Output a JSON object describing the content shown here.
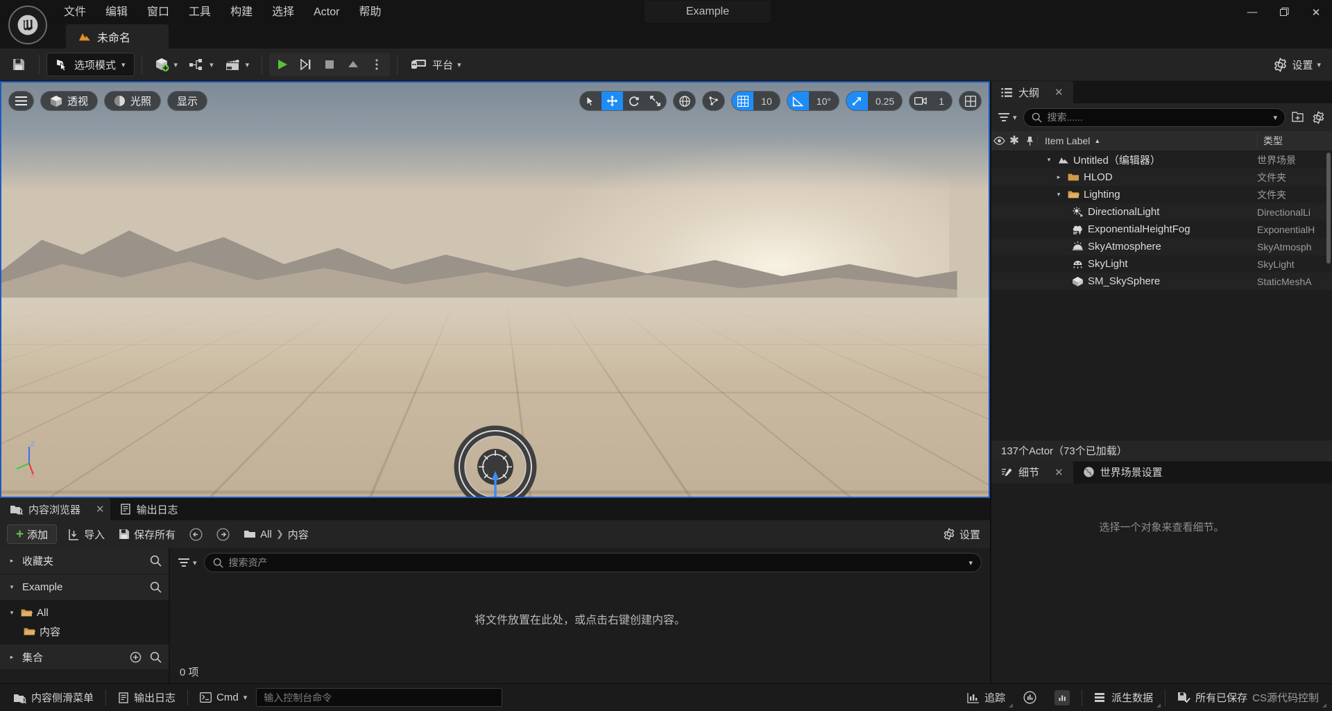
{
  "window": {
    "title": "Example",
    "minimize_label": "—",
    "maximize_label": "❐",
    "close_label": "✕"
  },
  "menubar": {
    "items": [
      {
        "label": "文件"
      },
      {
        "label": "编辑"
      },
      {
        "label": "窗口"
      },
      {
        "label": "工具"
      },
      {
        "label": "构建"
      },
      {
        "label": "选择"
      },
      {
        "label": "Actor"
      },
      {
        "label": "帮助"
      }
    ]
  },
  "level_tab": {
    "label": "未命名"
  },
  "toolbar": {
    "save_tooltip": "保存",
    "mode_label": "选项模式",
    "platform_label": "平台",
    "settings_label": "设置"
  },
  "viewport": {
    "menu_label": "☰",
    "perspective_label": "透视",
    "lighting_label": "光照",
    "show_label": "显示",
    "grid_snap_value": "10",
    "angle_snap_value": "10°",
    "scale_snap_value": "0.25",
    "camera_speed_value": "1",
    "axis_x": "X",
    "axis_y": "Y",
    "axis_z": "Z"
  },
  "outliner": {
    "tab_label": "大纲",
    "close_label": "✕",
    "search_placeholder": "搜索......",
    "columns": {
      "label": "Item Label",
      "type": "类型",
      "sort_arrow": "▲"
    },
    "rows": [
      {
        "name": "Untitled（编辑器）",
        "type": "世界场景",
        "depth": 1,
        "disclosure": "open",
        "icon": "world-icon"
      },
      {
        "name": "HLOD",
        "type": "文件夹",
        "depth": 2,
        "disclosure": "closed",
        "icon": "folder-closed-icon"
      },
      {
        "name": "Lighting",
        "type": "文件夹",
        "depth": 2,
        "disclosure": "open",
        "icon": "folder-open-icon"
      },
      {
        "name": "DirectionalLight",
        "type": "DirectionalLi",
        "depth": 3,
        "disclosure": "none",
        "icon": "directional-light-icon"
      },
      {
        "name": "ExponentialHeightFog",
        "type": "ExponentialH",
        "depth": 3,
        "disclosure": "none",
        "icon": "fog-icon"
      },
      {
        "name": "SkyAtmosphere",
        "type": "SkyAtmosph",
        "depth": 3,
        "disclosure": "none",
        "icon": "sky-atmosphere-icon"
      },
      {
        "name": "SkyLight",
        "type": "SkyLight",
        "depth": 3,
        "disclosure": "none",
        "icon": "sky-light-icon"
      },
      {
        "name": "SM_SkySphere",
        "type": "StaticMeshA",
        "depth": 3,
        "disclosure": "none",
        "icon": "static-mesh-icon"
      }
    ],
    "status": "137个Actor（73个已加载）"
  },
  "details": {
    "tab_label": "细节",
    "close_label": "✕",
    "world_settings_label": "世界场景设置",
    "empty_message": "选择一个对象来查看细节。"
  },
  "content_browser": {
    "tab_label": "内容浏览器",
    "close_label": "✕",
    "log_tab_label": "输出日志",
    "add_label": "添加",
    "import_label": "导入",
    "save_all_label": "保存所有",
    "breadcrumb": [
      "All",
      "内容"
    ],
    "settings_label": "设置",
    "favorites_label": "收藏夹",
    "project_label": "Example",
    "tree": [
      {
        "label": "All",
        "depth": 0,
        "disclosure": "open"
      },
      {
        "label": "内容",
        "depth": 1,
        "disclosure": "none"
      }
    ],
    "collections_label": "集合",
    "search_placeholder": "搜索资产",
    "dropzone_message": "将文件放置在此处，或点击右键创建内容。",
    "item_count": "0 项"
  },
  "statusbar": {
    "content_drawer_label": "内容侧滑菜单",
    "output_log_label": "输出日志",
    "cmd_label": "Cmd",
    "console_placeholder": "输入控制台命令",
    "trace_label": "追踪",
    "derived_data_label": "派生数据",
    "all_saved_label": "所有已保存",
    "revision_control_label": "CS源代码控制"
  },
  "colors": {
    "accent_blue": "#1f8cf5",
    "viewport_border": "#1b5bbf",
    "add_green": "#68c24a",
    "folder_orange": "#d19a4a",
    "panel_bg": "#1d1d1d",
    "toolbar_bg": "#242424"
  }
}
